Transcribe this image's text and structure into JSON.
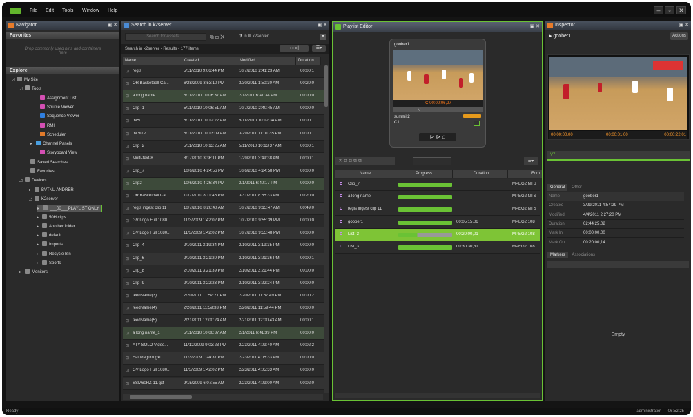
{
  "menu": {
    "logo": "GV",
    "items": [
      "File",
      "Edit",
      "Tools",
      "Window",
      "Help"
    ]
  },
  "navigator": {
    "title": "Navigator",
    "favorites_header": "Favorites",
    "favorites_hint": "Drop commonly used bins and containers here",
    "explore_header": "Explore",
    "tree": [
      "My Site",
      "Tools",
      "Assignment List",
      "Source Viewer",
      "Sequence Viewer",
      "RMI",
      "Scheduler",
      "Channel Panels",
      "Storyboard View",
      "Saved Searches",
      "Favorites",
      "Devices",
      "BVTNL-ANDRER",
      "K2server",
      "___00___PLAYLIST ONLY",
      "50H clips",
      "Another folder",
      "default",
      "Imports",
      "Recycle Bin",
      "Sports",
      "Monitors"
    ]
  },
  "search": {
    "title": "Search in k2server",
    "placeholder": "Search for Assets",
    "in_label": "in",
    "scope": "k2server",
    "results_label": "Search in k2server  -  Results  -  177 items",
    "columns": [
      "Name",
      "Created",
      "Modified",
      "Duration"
    ],
    "rows": [
      [
        "regis",
        "5/11/2010 9:06:44 PM",
        "10/7/2010 2:41:23 AM",
        "00:00:1"
      ],
      [
        "OR Basketball Ca...",
        "6/28/2009 3:53:10 PM",
        "3/30/2011 1:50:30 AM",
        "00:20:0"
      ],
      [
        "a long name",
        "5/11/2010 10:06:37 AM",
        "2/1/2011 6:41:34 PM",
        "00:00:0"
      ],
      [
        "Clip_1",
        "5/11/2010 10:06:51 AM",
        "10/7/2010 2:40:45 AM",
        "00:00:0"
      ],
      [
        "dv50",
        "5/11/2010 10:12:22 AM",
        "5/11/2010 10:12:34 AM",
        "00:00:1"
      ],
      [
        "dv 50 2",
        "5/11/2010 10:13:09 AM",
        "3/29/2011 11:01:35 PM",
        "00:00:1"
      ],
      [
        "Clip_2",
        "5/11/2010 10:13:25 AM",
        "5/11/2010 10:13:37 AM",
        "00:00:1"
      ],
      [
        "Multi-text-8",
        "8/17/2010 3:36:11 PM",
        "1/29/2011 3:49:38 AM",
        "00:00:1"
      ],
      [
        "Clip_7",
        "10/6/2010 4:24:56 PM",
        "10/6/2010 4:24:58 PM",
        "00:00:0"
      ],
      [
        "Clip2",
        "10/6/2010 4:26:34 PM",
        "2/1/2011 6:40:17 PM",
        "00:00:0"
      ],
      [
        "OR Basketball Ca...",
        "10/7/2010 8:11:46 PM",
        "3/31/2011 8:55:33 AM",
        "00:20:0"
      ],
      [
        "regis ingest clip 11",
        "10/7/2010 8:26:40 AM",
        "10/7/2010 9:15:47 AM",
        "00:49:0"
      ],
      [
        "GV Logo Full 1080...",
        "11/3/2009 1:42:02 PM",
        "10/7/2010 9:55:39 PM",
        "00:00:0"
      ],
      [
        "GV Logo Full 1080...",
        "11/3/2009 1:42:02 PM",
        "10/7/2010 9:55:48 PM",
        "00:00:0"
      ],
      [
        "Clip_4",
        "2/10/2011 3:19:34 PM",
        "2/10/2011 3:19:35 PM",
        "00:00:0"
      ],
      [
        "Clip_6",
        "2/10/2011 3:21:20 PM",
        "2/10/2011 3:21:36 PM",
        "00:00:1"
      ],
      [
        "Clip_8",
        "2/10/2011 3:21:39 PM",
        "2/10/2011 3:21:44 PM",
        "00:00:0"
      ],
      [
        "Clip_9",
        "2/10/2011 3:22:23 PM",
        "2/10/2011 3:22:24 PM",
        "00:00:0"
      ],
      [
        "feedName(3)",
        "2/20/2011 11:57:21 PM",
        "2/20/2011 11:57:49 PM",
        "00:00:2"
      ],
      [
        "feedName(4)",
        "2/20/2011 11:59:33 PM",
        "2/20/2011 11:59:44 PM",
        "00:00:0"
      ],
      [
        "feedName(5)",
        "2/21/2011 12:00:24 AM",
        "2/21/2011 12:00:43 AM",
        "00:00:1"
      ],
      [
        "a long name_1",
        "5/11/2010 10:06:37 AM",
        "2/1/2011 6:41:39 PM",
        "00:00:0"
      ],
      [
        "ATY-SOLO Video...",
        "11/12/2009 9:03:23 PM",
        "2/23/2011 4:09:40 AM",
        "00:02:2"
      ],
      [
        "Eat Maguro.gxf",
        "11/3/2009 1:24:37 PM",
        "2/23/2011 4:05:33 AM",
        "00:00:0"
      ],
      [
        "GV Logo Full 1080...",
        "11/3/2009 1:42:02 PM",
        "2/23/2011 4:05:33 AM",
        "00:00:0"
      ],
      [
        "SSM60HZ-11.gxf",
        "9/15/2009 6:07:55 AM",
        "2/23/2011 4:09:00 AM",
        "00:02:0"
      ],
      [
        "Channel Fkox.gxf",
        "11/17/2009 3:19:28 PM",
        "2/23/2011 4:05:43 AM",
        "00:00:0"
      ]
    ]
  },
  "playlist": {
    "title": "Playlist Editor",
    "preview_name": "goober1",
    "preview_timecode": "C 00:00:06,27",
    "clip_title": "summit2",
    "clip_sub": "C1",
    "columns": [
      "Name",
      "Progress",
      "Duration",
      "Fom"
    ],
    "rows": [
      {
        "name": "Clip_7",
        "progress": 1.0,
        "duration": "",
        "format": "MPEG2 NTS"
      },
      {
        "name": "a long name",
        "progress": 1.0,
        "duration": "",
        "format": "MPEG2 NTS"
      },
      {
        "name": "regis ingest clip 11",
        "progress": 1.0,
        "duration": "",
        "format": "MPEG2 NTS"
      },
      {
        "name": "goober1",
        "progress": 1.0,
        "duration": "00:05:15,06",
        "format": "MPEG2 108"
      },
      {
        "name": "List_3",
        "progress": 0.35,
        "duration": "00:20:00,01",
        "format": "MPEG2 108"
      },
      {
        "name": "List_3",
        "progress": 1.0,
        "duration": "00:30:30,31",
        "format": "MPEG2 108"
      }
    ]
  },
  "inspector": {
    "title": "Inspector",
    "name": "goober1",
    "actions_label": "Actions",
    "timecodes": [
      "00:00:00,00",
      "00:00:01,00",
      "00:00:22,01"
    ],
    "marker": "V7",
    "tabs": [
      "General",
      "Other"
    ],
    "fields": [
      [
        "Name",
        "goober1"
      ],
      [
        "Created",
        "3/29/2011 4:57:29 PM"
      ],
      [
        "Modified",
        "4/4/2011 2:27:20 PM"
      ],
      [
        "Duration",
        "02:44:25,02"
      ],
      [
        "Mark In",
        "00:00:00,00"
      ],
      [
        "Mark Out",
        "00:20:00,14"
      ]
    ],
    "bottom_tabs": [
      "Markers",
      "Associations"
    ],
    "empty_label": "Empty"
  },
  "status": {
    "left": "Ready",
    "user": "administrator",
    "time": "06:52:25"
  },
  "colors": {
    "accent_green": "#6ac235",
    "title_bar": "#3a404a",
    "panel": "#2a2a2a"
  }
}
